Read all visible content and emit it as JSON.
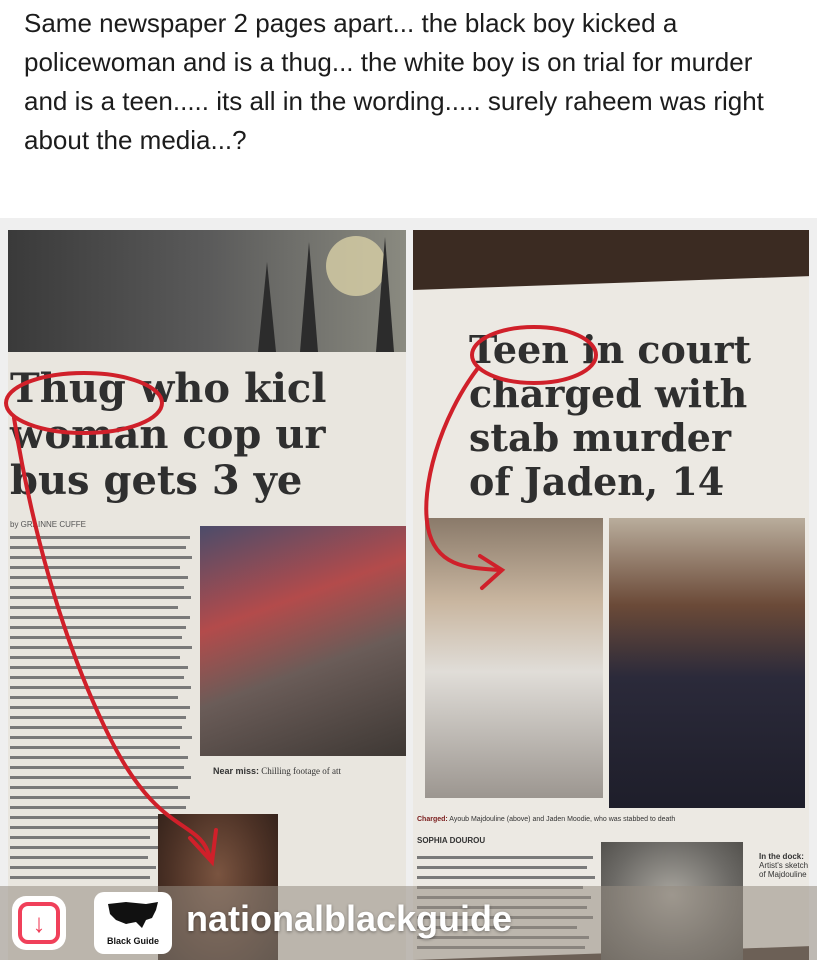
{
  "post": {
    "caption": "Same newspaper 2 pages apart... the black boy kicked a policewoman and is a thug... the white boy is on trial for murder and is a teen..... its all in the wording..... surely raheem was right about the media...?"
  },
  "left_clipping": {
    "headline_lines": [
      "Thug who kicl",
      "woman cop ur",
      "bus gets 3 ye"
    ],
    "byline": "by GRAINNE CUFFE",
    "near_miss_label": "Near miss:",
    "near_miss_text": "Chilling footage of att"
  },
  "right_clipping": {
    "headline_lines": [
      "Teen in court",
      "charged with",
      "stab murder",
      "of Jaden, 14"
    ],
    "photo_caption_label": "Charged:",
    "photo_caption_text": "Ayoub Majdouline (above) and Jaden Moodie, who was stabbed to death",
    "author": "SOPHIA DOUROU",
    "dock_label": "In the dock:",
    "dock_text": "Artist's sketch of Majdouline"
  },
  "watermark": {
    "instagram_icon": "instagram-icon",
    "logo_text": "Black Guide",
    "handle": "nationalblackguide"
  },
  "colors": {
    "annotation_red": "#d0202a",
    "instagram_red": "#f0405a"
  }
}
